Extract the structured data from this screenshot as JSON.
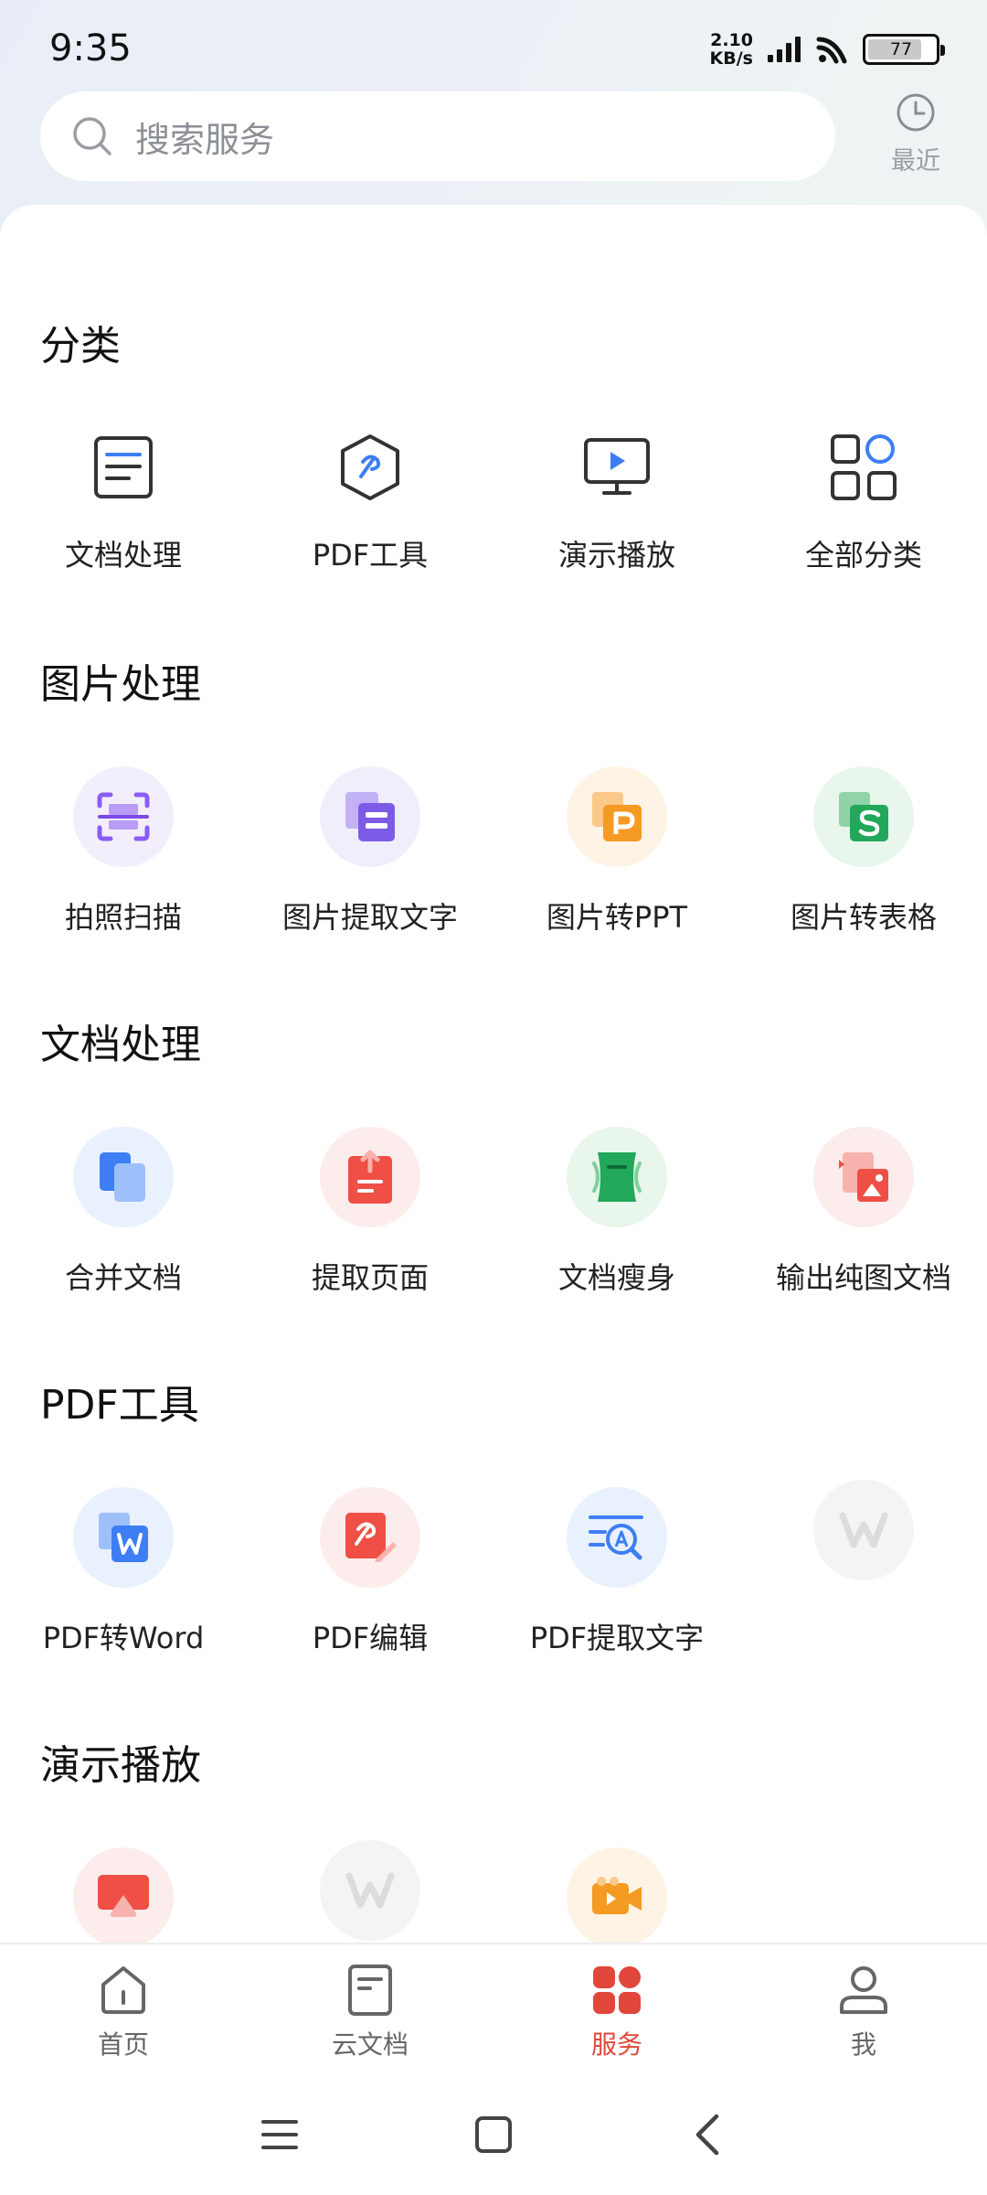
{
  "status_bar": {
    "time": "9:35",
    "net_speed_value": "2.10",
    "net_speed_unit": "KB/s",
    "battery": "77",
    "icons": [
      "signal-icon",
      "wifi-icon",
      "battery-icon"
    ]
  },
  "search": {
    "placeholder": "搜索服务",
    "icon": "search-icon"
  },
  "recent": {
    "label": "最近",
    "icon": "clock-icon"
  },
  "sections": {
    "category": {
      "title": "分类",
      "items": [
        {
          "label": "文档处理",
          "icon": "document-icon"
        },
        {
          "label": "PDF工具",
          "icon": "pdf-tool-icon"
        },
        {
          "label": "演示播放",
          "icon": "presentation-icon"
        },
        {
          "label": "全部分类",
          "icon": "all-categories-icon"
        }
      ]
    },
    "image": {
      "title": "图片处理",
      "items": [
        {
          "label": "拍照扫描",
          "icon": "scan-icon",
          "color": "#8b5cf6"
        },
        {
          "label": "图片提取文字",
          "icon": "image-to-text-icon",
          "color": "#7c5ce6"
        },
        {
          "label": "图片转PPT",
          "icon": "image-to-ppt-icon",
          "color": "#f59a23"
        },
        {
          "label": "图片转表格",
          "icon": "image-to-sheet-icon",
          "color": "#22a85a"
        }
      ]
    },
    "document": {
      "title": "文档处理",
      "items": [
        {
          "label": "合并文档",
          "icon": "merge-doc-icon",
          "color": "#3d7ef5"
        },
        {
          "label": "提取页面",
          "icon": "extract-page-icon",
          "color": "#ef4f45"
        },
        {
          "label": "文档瘦身",
          "icon": "slim-doc-icon",
          "color": "#22a85a"
        },
        {
          "label": "输出纯图文档",
          "icon": "export-image-doc-icon",
          "color": "#ef4f45"
        }
      ]
    },
    "pdf": {
      "title": "PDF工具",
      "items": [
        {
          "label": "PDF转Word",
          "icon": "pdf-to-word-icon",
          "color": "#3d7ef5"
        },
        {
          "label": "PDF编辑",
          "icon": "pdf-edit-icon",
          "color": "#ef4f45"
        },
        {
          "label": "PDF提取文字",
          "icon": "pdf-extract-text-icon",
          "color": "#3d7ef5"
        },
        {
          "label": "",
          "icon": "wps-placeholder-icon"
        }
      ]
    },
    "presentation": {
      "title": "演示播放",
      "items": [
        {
          "label": "",
          "icon": "screen-cast-icon",
          "color": "#ef4f45"
        },
        {
          "label": "",
          "icon": "wps-placeholder-icon"
        },
        {
          "label": "",
          "icon": "video-record-icon",
          "color": "#f59a23"
        }
      ]
    }
  },
  "bottom_nav": {
    "items": [
      {
        "label": "首页",
        "icon": "home-icon"
      },
      {
        "label": "云文档",
        "icon": "cloud-doc-icon"
      },
      {
        "label": "服务",
        "icon": "services-icon",
        "active": true
      },
      {
        "label": "我",
        "icon": "profile-icon"
      }
    ],
    "active_color": "#e0473a"
  },
  "system_nav": {
    "icons": [
      "menu-icon",
      "home-square-icon",
      "back-icon"
    ]
  }
}
